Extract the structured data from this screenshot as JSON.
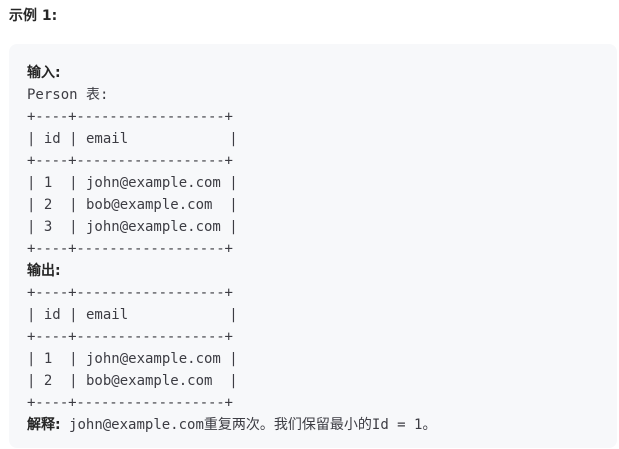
{
  "example": {
    "title": "示例 1:",
    "input_label": "输入:",
    "table_name_line": "Person 表:",
    "input_table": {
      "border": "+----+------------------+",
      "header": "| id | email            |",
      "rows": [
        "| 1  | john@example.com |",
        "| 2  | bob@example.com  |",
        "| 3  | john@example.com |"
      ]
    },
    "output_label": "输出:",
    "output_table": {
      "border": "+----+------------------+",
      "header": "| id | email            |",
      "rows": [
        "| 1  | john@example.com |",
        "| 2  | bob@example.com  |"
      ]
    },
    "explanation_label": "解释:",
    "explanation_text": " john@example.com重复两次。我们保留最小的Id = 1。"
  }
}
